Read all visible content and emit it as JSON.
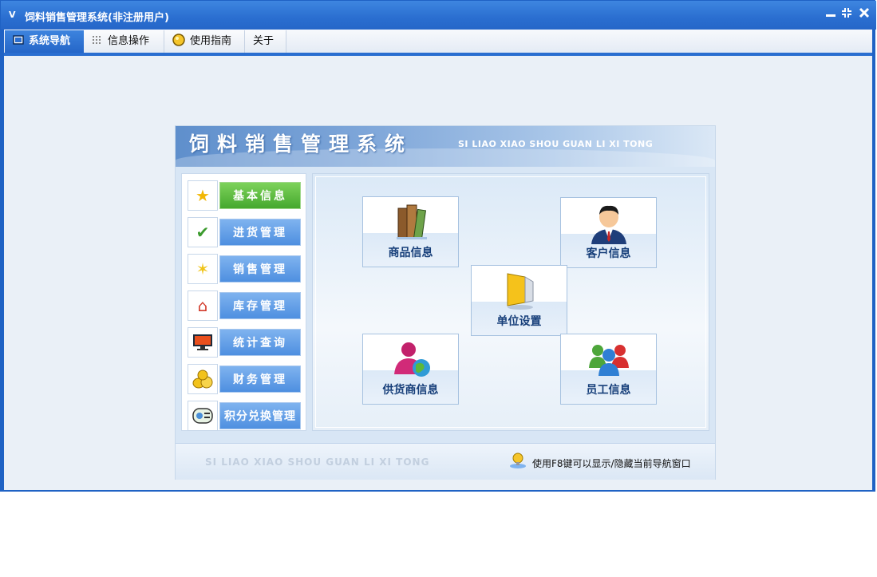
{
  "window": {
    "title": "饲料销售管理系统(非注册用户)",
    "app_icon": "V"
  },
  "menu": {
    "tabs": [
      {
        "label": "系统导航",
        "icon": "window-icon"
      },
      {
        "label": "信息操作",
        "icon": "grid-icon"
      },
      {
        "label": "使用指南",
        "icon": "lightbulb-icon"
      },
      {
        "label": "关于",
        "icon": ""
      }
    ]
  },
  "banner": {
    "cn_title": "饲料销售管理系统",
    "en_title": "SI LIAO XIAO SHOU GUAN LI XI TONG"
  },
  "sidebar": {
    "items": [
      {
        "label": "基本信息",
        "icon": "star-icon"
      },
      {
        "label": "进货管理",
        "icon": "check-icon"
      },
      {
        "label": "销售管理",
        "icon": "sparkle-icon"
      },
      {
        "label": "库存管理",
        "icon": "house-icon"
      },
      {
        "label": "统计查询",
        "icon": "monitor-icon"
      },
      {
        "label": "财务管理",
        "icon": "coins-icon"
      },
      {
        "label": "积分兑换管理",
        "icon": "card-icon"
      }
    ]
  },
  "tiles": {
    "goods": {
      "label": "商品信息",
      "icon": "books-icon"
    },
    "customer": {
      "label": "客户信息",
      "icon": "person-icon"
    },
    "unit": {
      "label": "单位设置",
      "icon": "monitor-icon"
    },
    "supplier": {
      "label": "供货商信息",
      "icon": "people-globe-icon"
    },
    "staff": {
      "label": "员工信息",
      "icon": "group-icon"
    }
  },
  "footer": {
    "en": "SI LIAO XIAO SHOU GUAN LI XI TONG",
    "hint": "使用F8键可以显示/隐藏当前导航窗口"
  }
}
